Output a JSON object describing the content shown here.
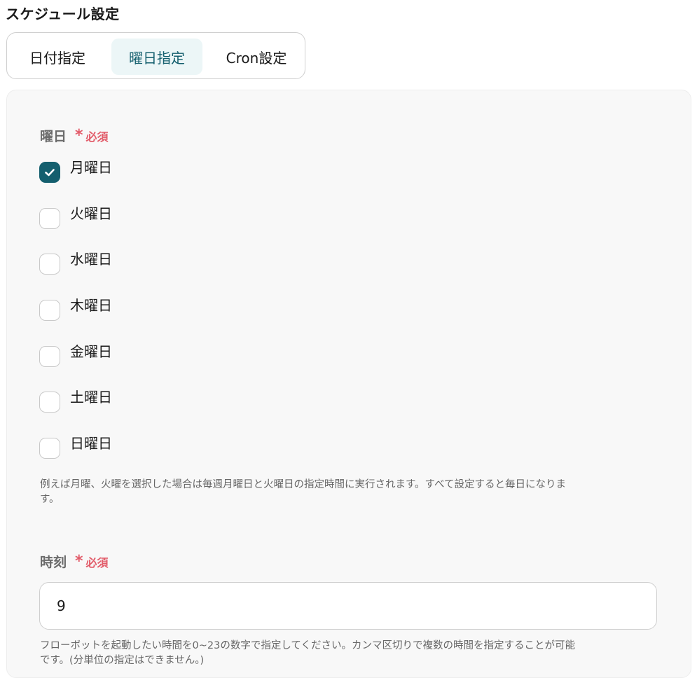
{
  "page": {
    "title": "スケジュール設定"
  },
  "tabs": [
    {
      "label": "日付指定",
      "active": false
    },
    {
      "label": "曜日指定",
      "active": true
    },
    {
      "label": "Cron設定",
      "active": false
    }
  ],
  "weekday": {
    "label": "曜日",
    "required_mark": "*",
    "required_text": "必須",
    "options": [
      {
        "label": "月曜日",
        "checked": true
      },
      {
        "label": "火曜日",
        "checked": false
      },
      {
        "label": "水曜日",
        "checked": false
      },
      {
        "label": "木曜日",
        "checked": false
      },
      {
        "label": "金曜日",
        "checked": false
      },
      {
        "label": "土曜日",
        "checked": false
      },
      {
        "label": "日曜日",
        "checked": false
      }
    ],
    "help_line1": "例えば月曜、火曜を選択した場合は毎週月曜日と火曜日の指定時間に実行されます。すべて設定すると毎日になりま",
    "help_line2": "す。"
  },
  "time": {
    "label": "時刻",
    "required_mark": "*",
    "required_text": "必須",
    "value": "9",
    "help_line1": "フローボットを起動したい時間を0~23の数字で指定してください。カンマ区切りで複数の時間を指定することが可能",
    "help_line2": "です。(分単位の指定はできません。)"
  },
  "colors": {
    "accent": "#145f6e",
    "active_tab_bg": "#ecf6f7",
    "required": "#e25c6a"
  },
  "icons": {
    "checkmark": "check-icon"
  }
}
